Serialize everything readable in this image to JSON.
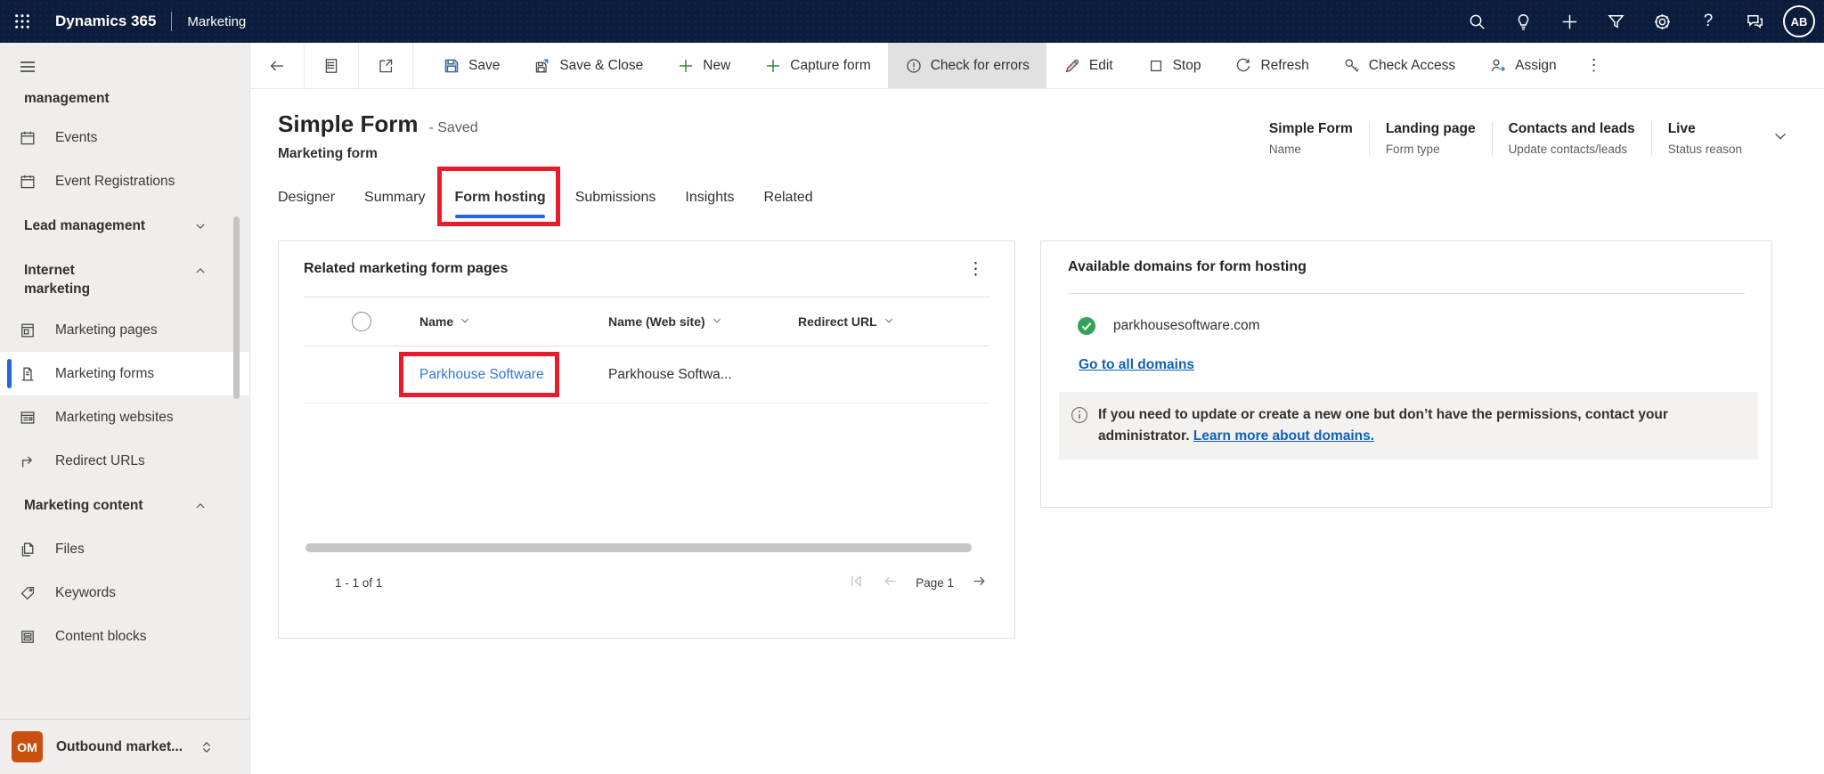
{
  "topbar": {
    "app_title": "Dynamics 365",
    "area_label": "Marketing",
    "avatar_initials": "AB"
  },
  "toolbar": {
    "items": [
      {
        "label": "Save"
      },
      {
        "label": "Save & Close"
      },
      {
        "label": "New"
      },
      {
        "label": "Capture form"
      },
      {
        "label": "Check for errors"
      },
      {
        "label": "Edit"
      },
      {
        "label": "Stop"
      },
      {
        "label": "Refresh"
      },
      {
        "label": "Check Access"
      },
      {
        "label": "Assign"
      }
    ]
  },
  "sidebar": {
    "clipped_group_label": "management",
    "events_label": "Events",
    "event_registrations_label": "Event Registrations",
    "lead_management_label": "Lead management",
    "internet_marketing_label": "Internet marketing",
    "marketing_pages_label": "Marketing pages",
    "marketing_forms_label": "Marketing forms",
    "marketing_websites_label": "Marketing websites",
    "redirect_urls_label": "Redirect URLs",
    "marketing_content_label": "Marketing content",
    "files_label": "Files",
    "keywords_label": "Keywords",
    "content_blocks_label": "Content blocks",
    "area_switcher": {
      "badge": "OM",
      "label": "Outbound market..."
    }
  },
  "record": {
    "title": "Simple Form",
    "status": "- Saved",
    "entity_type": "Marketing form",
    "header_fields": [
      {
        "value": "Simple Form",
        "label": "Name"
      },
      {
        "value": "Landing page",
        "label": "Form type"
      },
      {
        "value": "Contacts and leads",
        "label": "Update contacts/leads"
      },
      {
        "value": "Live",
        "label": "Status reason"
      }
    ],
    "tabs": [
      {
        "label": "Designer"
      },
      {
        "label": "Summary"
      },
      {
        "label": "Form hosting"
      },
      {
        "label": "Submissions"
      },
      {
        "label": "Insights"
      },
      {
        "label": "Related"
      }
    ]
  },
  "form_pages_card": {
    "title": "Related marketing form pages",
    "columns": [
      "Name",
      "Name (Web site)",
      "Redirect URL"
    ],
    "rows": [
      {
        "name": "Parkhouse Software",
        "website_name": "Parkhouse Softwa..."
      }
    ],
    "record_count": "1 - 1 of 1",
    "page_label": "Page 1"
  },
  "domains_card": {
    "title": "Available domains for form hosting",
    "domain": "parkhousesoftware.com",
    "go_to_all_label": "Go to all domains",
    "info_text": "If you need to update or create a new one but don’t have the permissions, contact your administrator.",
    "info_link_label": "Learn more about domains."
  },
  "glyphs": {
    "more_vertical": "⋮",
    "help": "?"
  },
  "colors": {
    "accent_blue": "#2266e4",
    "link_blue": "#1160b7",
    "row_link_blue": "#3078d4",
    "annotation_red": "#ea1b2d",
    "success_green": "#33a457",
    "badge_orange": "#ca5010",
    "topbar_navy": "#0c1c3d"
  }
}
